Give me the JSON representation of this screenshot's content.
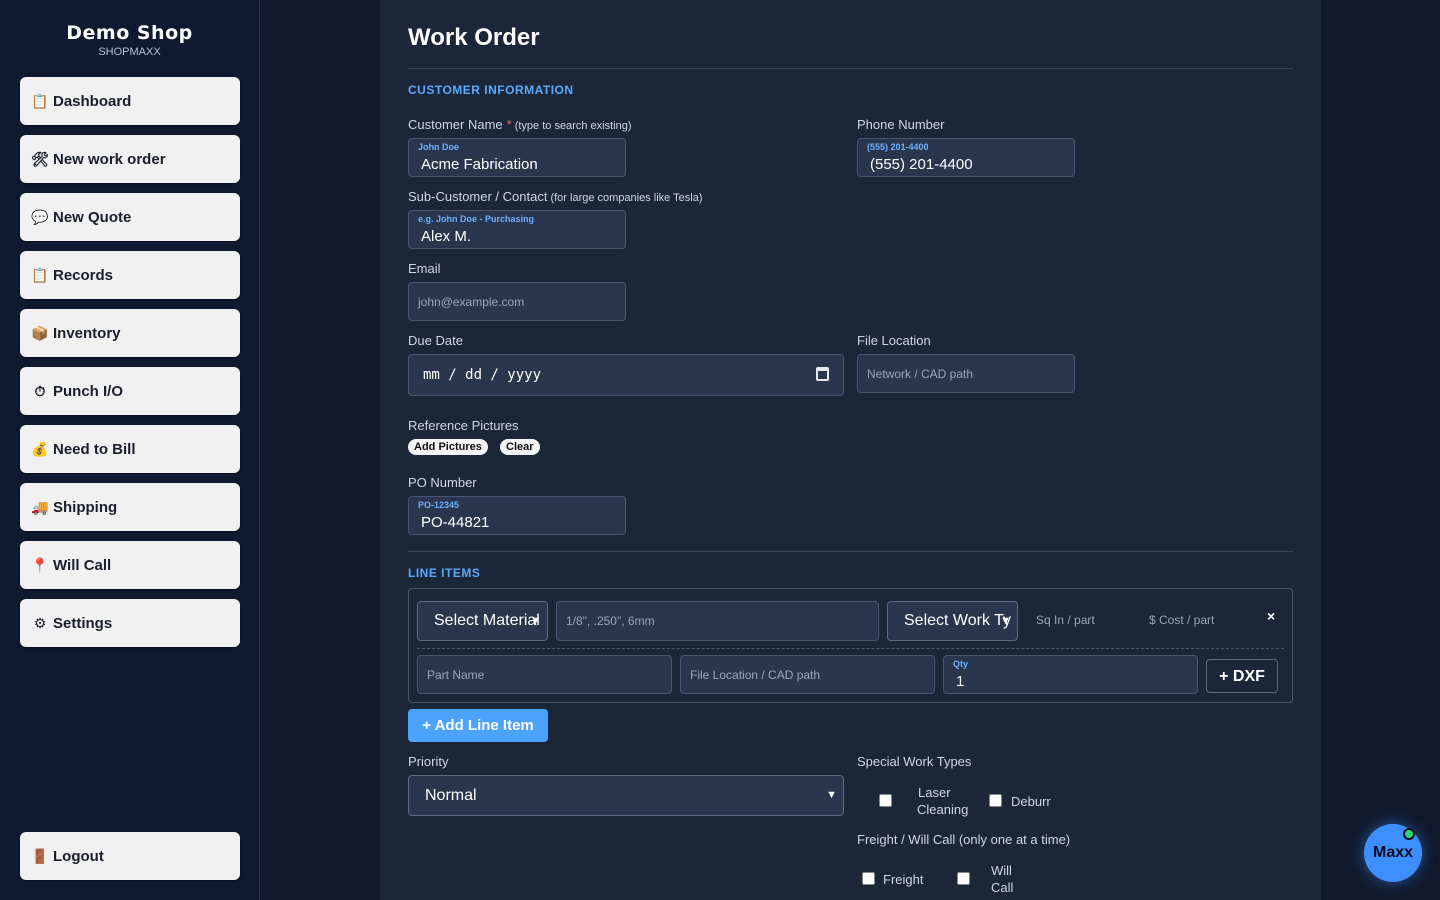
{
  "brand": {
    "title": "Demo Shop",
    "subtitle": "SHOPMAXX"
  },
  "sidebar": {
    "items": [
      {
        "label": "Dashboard",
        "icon": "clipboard-icon"
      },
      {
        "label": "New work order",
        "icon": "tools-icon"
      },
      {
        "label": "New Quote",
        "icon": "speech-bubble-icon"
      },
      {
        "label": "Records",
        "icon": "clipboard-icon"
      },
      {
        "label": "Inventory",
        "icon": "box-icon"
      },
      {
        "label": "Punch I/O",
        "icon": "stopwatch-icon"
      },
      {
        "label": "Need to Bill",
        "icon": "money-bag-icon"
      },
      {
        "label": "Shipping",
        "icon": "truck-icon"
      },
      {
        "label": "Will Call",
        "icon": "pin-icon"
      },
      {
        "label": "Settings",
        "icon": "gear-icon"
      }
    ],
    "logout": {
      "label": "Logout",
      "icon": "door-icon"
    }
  },
  "page": {
    "title": "Work Order"
  },
  "customer": {
    "section_title": "CUSTOMER INFORMATION",
    "name_label": "Customer Name",
    "name_required": "*",
    "name_hint": "(type to search existing)",
    "name_placeholder": "John Doe",
    "name_value": "Acme Fabrication",
    "phone_label": "Phone Number",
    "phone_placeholder": "(555) 201-4400",
    "phone_value": "(555) 201-4400",
    "sub_label": "Sub-Customer / Contact",
    "sub_hint": "(for large companies like Tesla)",
    "sub_placeholder": "e.g. John Doe - Purchasing",
    "sub_value": "Alex M.",
    "email_label": "Email",
    "email_placeholder": "john@example.com",
    "due_label": "Due Date",
    "due_value": "mm / dd / yyyy",
    "file_label": "File Location",
    "file_placeholder": "Network / CAD path",
    "pictures_label": "Reference Pictures",
    "add_pictures": "Add Pictures",
    "clear": "Clear",
    "po_label": "PO Number",
    "po_placeholder": "PO-12345",
    "po_value": "PO-44821"
  },
  "line_items": {
    "section_title": "LINE ITEMS",
    "material_select": "Select Material",
    "thickness_placeholder": "1/8\", .250\", 6mm",
    "work_type_select": "Select Work Ty",
    "sq_in": "Sq In / part",
    "cost": "$ Cost / part",
    "remove": "×",
    "part_name_placeholder": "Part Name",
    "file_placeholder": "File Location / CAD path",
    "qty_label": "Qty",
    "qty_value": "1",
    "dxf_button": "+ DXF",
    "add_button": "+ Add Line Item"
  },
  "options": {
    "priority_label": "Priority",
    "priority_value": "Normal",
    "special_label": "Special Work Types",
    "laser_line1": "Laser",
    "laser_line2": "Cleaning",
    "deburr": "Deburr",
    "freight_label": "Freight / Will Call (only one at a time)",
    "freight": "Freight",
    "will_line1": "Will",
    "will_line2": "Call"
  },
  "assistant": {
    "label": "Maxx"
  }
}
